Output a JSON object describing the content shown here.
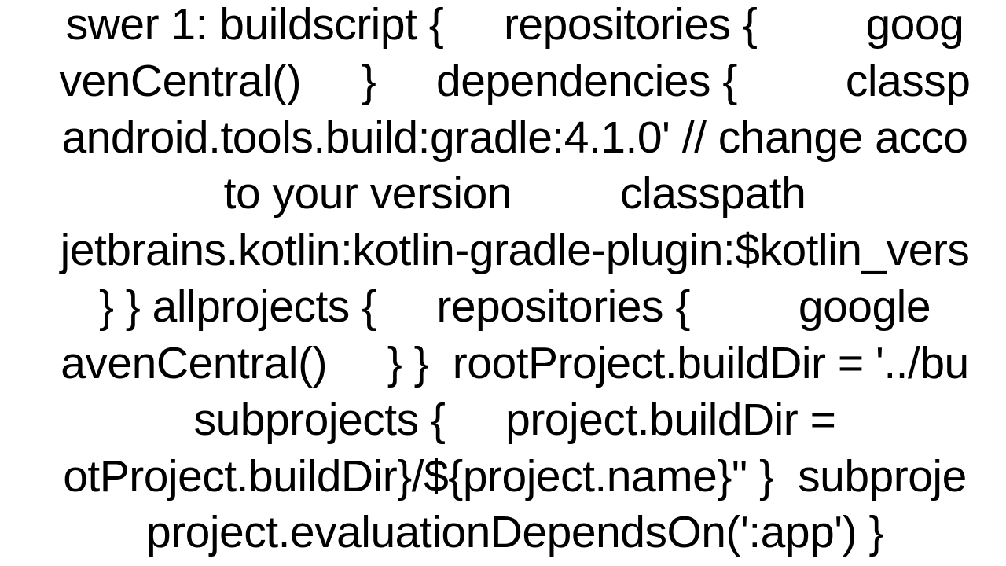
{
  "content": {
    "text": "swer 1: buildscript {     repositories {         goog\nvenCentral()     }     dependencies {         classp\nandroid.tools.build:gradle:4.1.0' // change acco\nto your version         classpath\njetbrains.kotlin:kotlin-gradle-plugin:$kotlin_vers\n} } allprojects {     repositories {         google\navenCentral()     } }  rootProject.buildDir = '../bu\nsubprojects {     project.buildDir =\notProject.buildDir}/${project.name}\" }  subproje\nproject.evaluationDependsOn(':app') }"
  }
}
